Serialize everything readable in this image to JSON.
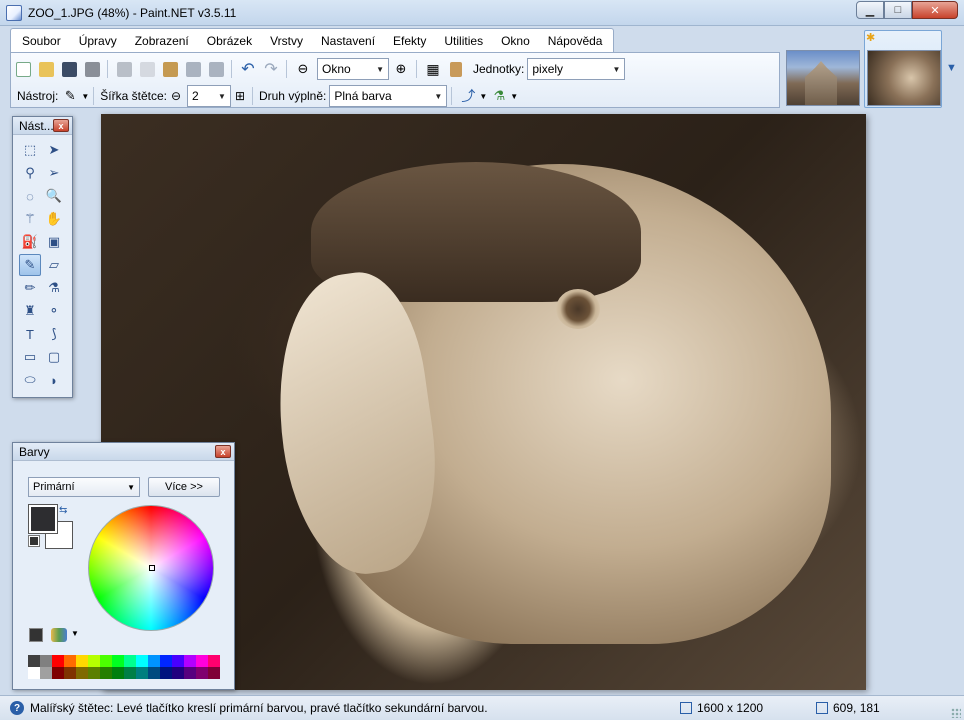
{
  "window": {
    "title": "ZOO_1.JPG (48%) - Paint.NET v3.5.11",
    "min_label": "▁",
    "max_label": "□",
    "close_label": "✕"
  },
  "menu": {
    "items": [
      "Soubor",
      "Úpravy",
      "Zobrazení",
      "Obrázek",
      "Vrstvy",
      "Nastavení",
      "Efekty",
      "Utilities",
      "Okno",
      "Nápověda"
    ]
  },
  "toolbar": {
    "zoom_value": "Okno",
    "units_label": "Jednotky:",
    "units_value": "pixely",
    "tool_label": "Nástroj:",
    "brush_width_label": "Šířka štětce:",
    "brush_width_value": "2",
    "fill_label": "Druh výplně:",
    "fill_value": "Plná barva"
  },
  "tools_window": {
    "title": "Nást...",
    "close_label": "x",
    "tools": [
      {
        "icon": "rectangle-select-icon",
        "glyph": "⬚"
      },
      {
        "icon": "move-selection-icon",
        "glyph": "➤"
      },
      {
        "icon": "lasso-select-icon",
        "glyph": "⚲"
      },
      {
        "icon": "move-selected-icon",
        "glyph": "➢"
      },
      {
        "icon": "ellipse-select-icon",
        "glyph": "◌"
      },
      {
        "icon": "zoom-icon",
        "glyph": "🔍"
      },
      {
        "icon": "magic-wand-icon",
        "glyph": "⚚"
      },
      {
        "icon": "pan-hand-icon",
        "glyph": "✋"
      },
      {
        "icon": "paint-bucket-icon",
        "glyph": "⛽"
      },
      {
        "icon": "gradient-icon",
        "glyph": "▣"
      },
      {
        "icon": "paintbrush-icon",
        "glyph": "✎"
      },
      {
        "icon": "eraser-icon",
        "glyph": "▱"
      },
      {
        "icon": "pencil-icon",
        "glyph": "✏"
      },
      {
        "icon": "color-picker-icon",
        "glyph": "⚗"
      },
      {
        "icon": "clone-stamp-icon",
        "glyph": "♜"
      },
      {
        "icon": "recolor-icon",
        "glyph": "⚬"
      },
      {
        "icon": "text-icon",
        "glyph": "T"
      },
      {
        "icon": "line-curve-icon",
        "glyph": "⟆"
      },
      {
        "icon": "rectangle-icon",
        "glyph": "▭"
      },
      {
        "icon": "rounded-rectangle-icon",
        "glyph": "▢"
      },
      {
        "icon": "ellipse-icon",
        "glyph": "⬭"
      },
      {
        "icon": "freeform-shape-icon",
        "glyph": "◗"
      }
    ],
    "active_index": 10
  },
  "colors_window": {
    "title": "Barvy",
    "close_label": "x",
    "selector_value": "Primární",
    "more_button": "Více >>",
    "primary_color": "#2d2d30",
    "secondary_color": "#ffffff",
    "palette_row1": [
      "#404040",
      "#808080",
      "#ff0000",
      "#ff6a00",
      "#ffd800",
      "#b6ff00",
      "#4cff00",
      "#00ff21",
      "#00ff90",
      "#00ffff",
      "#0094ff",
      "#0026ff",
      "#4800ff",
      "#b200ff",
      "#ff00dc",
      "#ff006e"
    ],
    "palette_row2": [
      "#ffffff",
      "#a0a0a0",
      "#7f0000",
      "#7f3300",
      "#7f6a00",
      "#5b7f00",
      "#267f00",
      "#007f0e",
      "#007f46",
      "#007f7f",
      "#004a7f",
      "#00137f",
      "#21007f",
      "#57007f",
      "#7f006e",
      "#7f0037"
    ]
  },
  "status": {
    "help_glyph": "?",
    "message": "Malířský štětec: Levé tlačítko kreslí primární barvou, pravé tlačítko sekundární barvou.",
    "image_size": "1600 x 1200",
    "cursor_pos": "609, 181"
  }
}
